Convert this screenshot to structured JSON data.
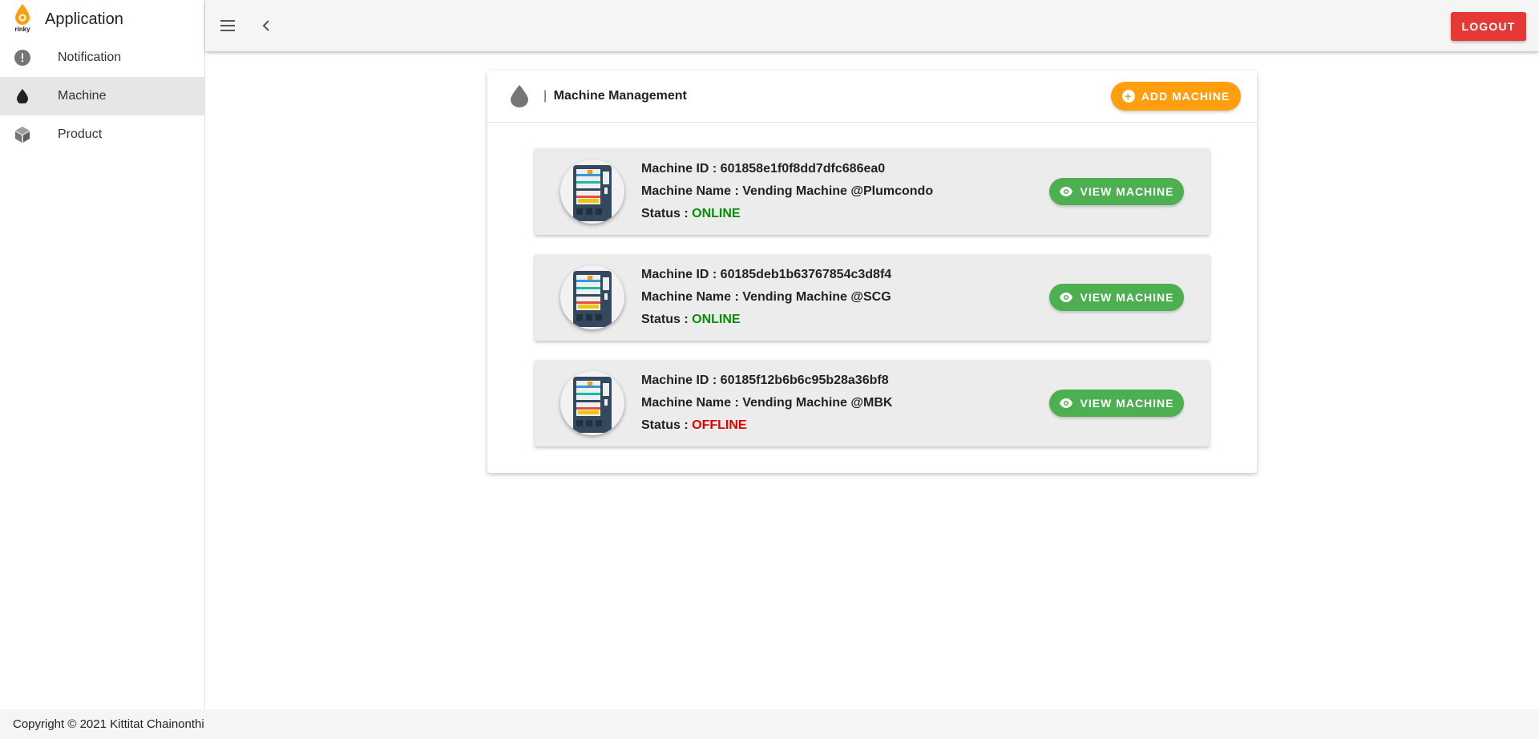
{
  "app": {
    "logo_text": "rinky",
    "title": "Application"
  },
  "sidebar": {
    "items": [
      {
        "label": "Notification",
        "icon": "alert-circle-icon"
      },
      {
        "label": "Machine",
        "icon": "water-drop-icon",
        "active": true
      },
      {
        "label": "Product",
        "icon": "cube-icon"
      }
    ]
  },
  "topbar": {
    "logout_label": "LOGOUT"
  },
  "card": {
    "title_sep": "|",
    "title": "Machine Management",
    "add_label": "ADD MACHINE"
  },
  "machines": [
    {
      "id_line": "Machine ID : 601858e1f0f8dd7dfc686ea0",
      "name_line": "Machine Name : Vending Machine @Plumcondo",
      "status_prefix": "Status :",
      "status": "ONLINE",
      "view_label": "VIEW MACHINE"
    },
    {
      "id_line": "Machine ID : 60185deb1b63767854c3d8f4",
      "name_line": "Machine Name : Vending Machine @SCG",
      "status_prefix": "Status :",
      "status": "ONLINE",
      "view_label": "VIEW MACHINE"
    },
    {
      "id_line": "Machine ID : 60185f12b6b6c95b28a36bf8",
      "name_line": "Machine Name : Vending Machine @MBK",
      "status_prefix": "Status :",
      "status": "OFFLINE",
      "view_label": "VIEW MACHINE"
    }
  ],
  "footer": {
    "copyright": "Copyright © 2021 Kittitat Chainonthi"
  },
  "colors": {
    "accent_orange": "#ff9f10",
    "logout_red": "#e53935",
    "view_green": "#4caf50",
    "online": "#0a8a0a",
    "offline": "#e00000"
  }
}
